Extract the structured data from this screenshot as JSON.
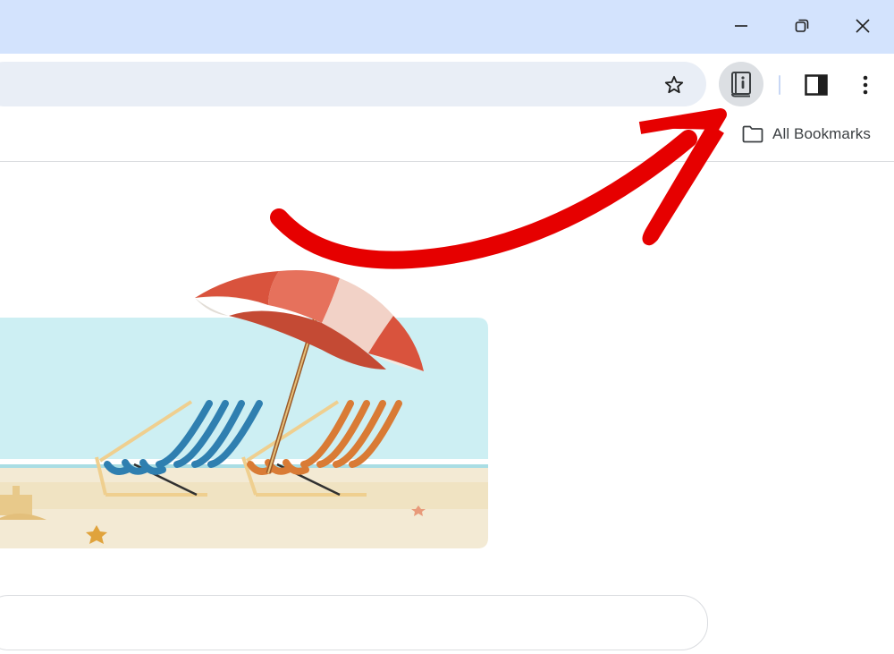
{
  "window": {
    "minimize_icon": "minimize-icon",
    "restore_icon": "restore-icon",
    "close_icon": "close-icon"
  },
  "toolbar": {
    "bookmark_star_icon": "star-icon",
    "reading_list_icon": "reading-list-icon",
    "side_panel_icon": "side-panel-icon",
    "menu_icon": "more-vert-icon"
  },
  "bookmarks_bar": {
    "folder_icon": "folder-icon",
    "all_bookmarks_label": "All Bookmarks"
  },
  "content": {
    "peek_text": "··· ·"
  },
  "colors": {
    "titlebar": "#d3e3fd",
    "omnibox": "#e9eef6",
    "arrow": "#e60000",
    "sky": "#cdeff3",
    "sand": "#f3ead4",
    "umbrella_red": "#d9533d",
    "chair_blue": "#2f7fb0",
    "chair_orange": "#d97b35"
  }
}
